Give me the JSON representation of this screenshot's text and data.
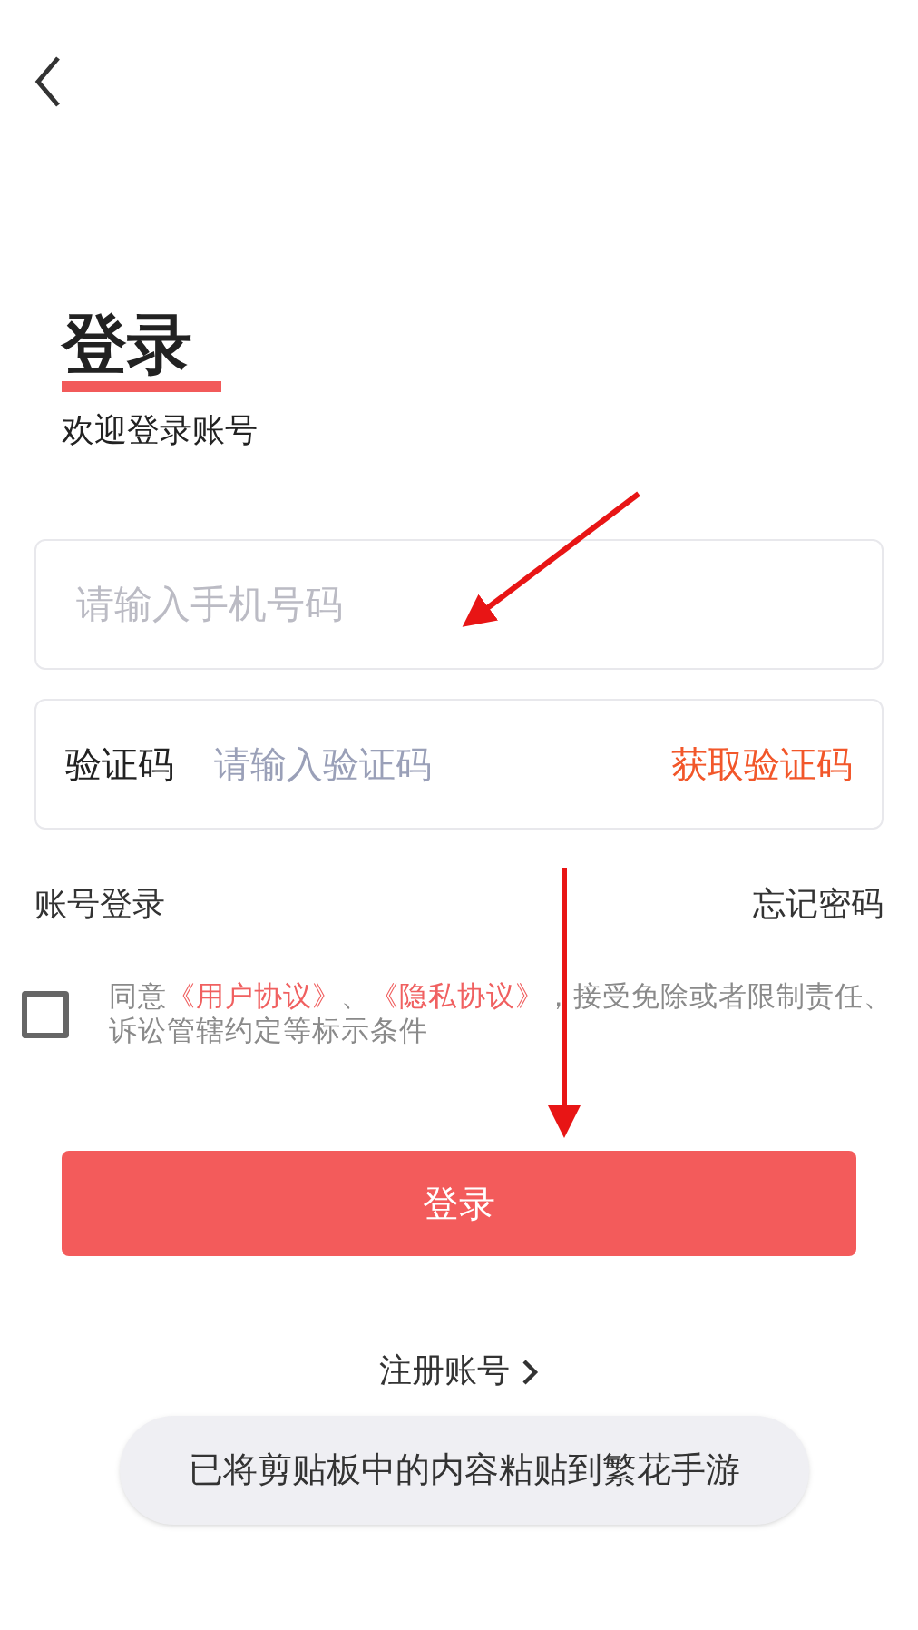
{
  "title": "登录",
  "subtitle": "欢迎登录账号",
  "phone_field": {
    "placeholder": "请输入手机号码"
  },
  "code_field": {
    "label": "验证码",
    "placeholder": "请输入验证码",
    "action": "获取验证码"
  },
  "links": [
    "账号登录",
    "忘记密码"
  ],
  "agreement": {
    "checked": false,
    "parts": [
      {
        "text": "同意",
        "kind": "plain"
      },
      {
        "text": "《用户协议》",
        "kind": "link"
      },
      {
        "text": "、",
        "kind": "plain"
      },
      {
        "text": "《隐私协议》",
        "kind": "link"
      },
      {
        "text": "，接受免除或者限制责任、诉讼管辖约定等标示条件",
        "kind": "plain"
      }
    ]
  },
  "login_button": "登录",
  "register_link": "注册账号",
  "toast": "已将剪贴板中的内容粘贴到繁花手游"
}
